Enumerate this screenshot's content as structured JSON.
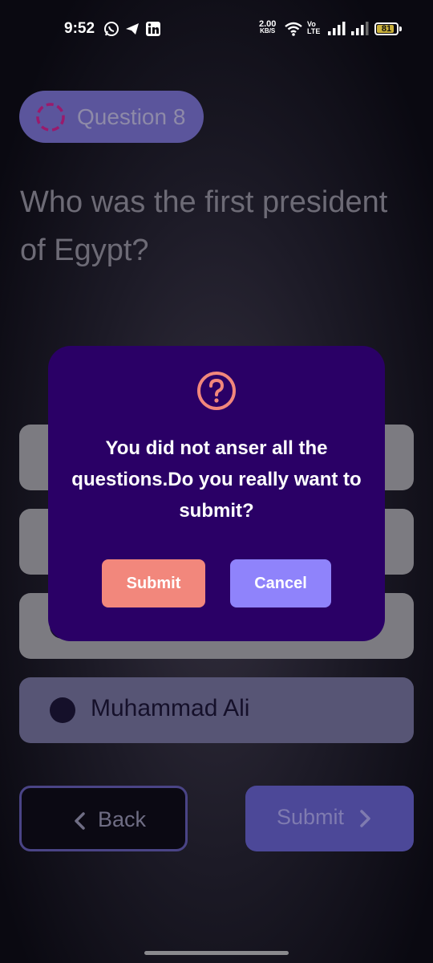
{
  "status_bar": {
    "time": "9:52",
    "net_speed_value": "2.00",
    "net_speed_unit": "KB/S",
    "volte_top": "Vo",
    "volte_bottom": "LTE",
    "battery_level": "81",
    "icons": [
      "whatsapp-icon",
      "telegram-icon",
      "linkedin-icon",
      "wifi-icon",
      "signal-icon"
    ]
  },
  "quiz": {
    "question_label": "Question 8",
    "question_text": "Who was the first president of Egypt?",
    "options": [
      {
        "label": ""
      },
      {
        "label": ""
      },
      {
        "label": ""
      },
      {
        "label": "Muhammad Ali"
      }
    ]
  },
  "nav": {
    "back_label": "Back",
    "submit_label": "Submit"
  },
  "dialog": {
    "icon": "help-circle-icon",
    "message": "You did not anser all the questions.Do you really want to submit?",
    "submit_label": "Submit",
    "cancel_label": "Cancel"
  },
  "colors": {
    "dialog_bg": "#2a0066",
    "dialog_submit": "#f2877c",
    "dialog_cancel": "#8f83fb",
    "pill_bg": "#5b559c",
    "ring": "#b0186e"
  }
}
